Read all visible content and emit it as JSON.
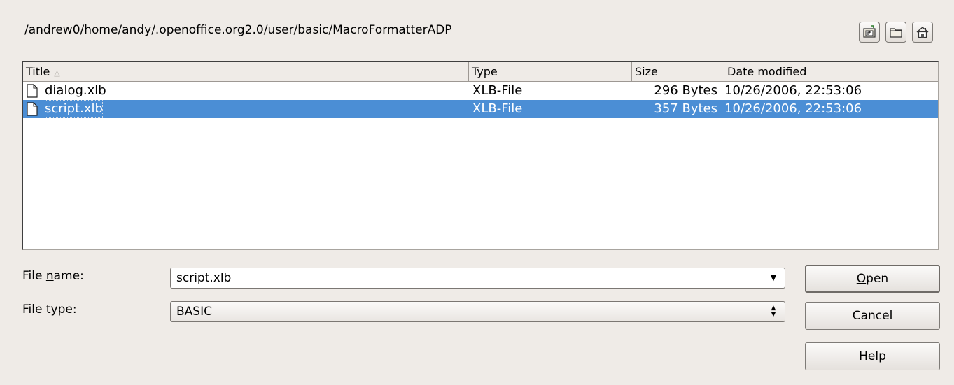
{
  "path": {
    "text": "/andrew0/home/andy/.openoffice.org2.0/user/basic/MacroFormatterADP"
  },
  "toolbar": {
    "icons": [
      "folder-up-icon",
      "new-folder-icon",
      "home-icon"
    ]
  },
  "list": {
    "columns": {
      "title": "Title",
      "type": "Type",
      "size": "Size",
      "date": "Date modified"
    },
    "rows": [
      {
        "name": "dialog.xlb",
        "type": "XLB-File",
        "size": "296 Bytes",
        "date": "10/26/2006, 22:53:06",
        "selected": false
      },
      {
        "name": "script.xlb",
        "type": "XLB-File",
        "size": "357 Bytes",
        "date": "10/26/2006, 22:53:06",
        "selected": true
      }
    ]
  },
  "form": {
    "file_name_label_pre": "File ",
    "file_name_label_mn": "n",
    "file_name_label_post": "ame:",
    "file_name_value": "script.xlb",
    "file_type_label_pre": "File ",
    "file_type_label_mn": "t",
    "file_type_label_post": "ype:",
    "file_type_value": "BASIC"
  },
  "buttons": {
    "open_mn": "O",
    "open_rest": "pen",
    "cancel": "Cancel",
    "help_mn": "H",
    "help_rest": "elp"
  },
  "colors": {
    "selection": "#4b8ed5",
    "background": "#efebe7"
  }
}
